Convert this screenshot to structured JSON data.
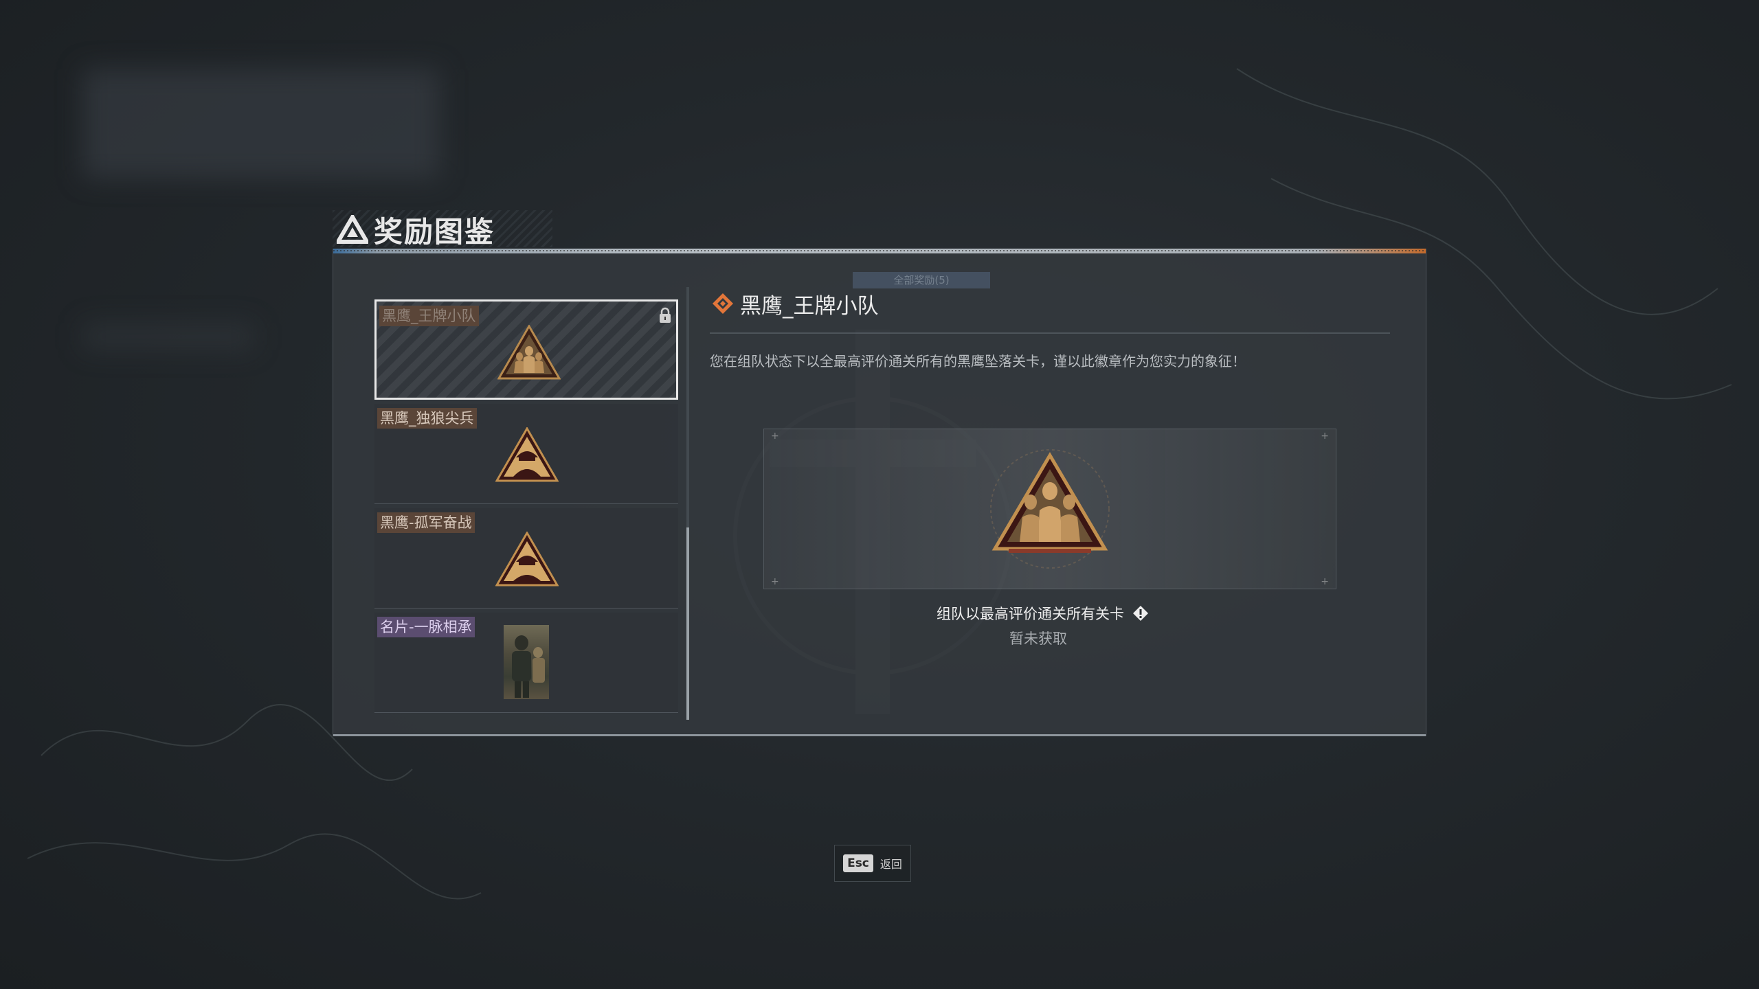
{
  "page": {
    "title": "奖励图鉴"
  },
  "panel": {
    "ghost_tab": "全部奖励(5)"
  },
  "rewards": [
    {
      "tag": "黑鹰_王牌小队",
      "selected": true,
      "locked": true
    },
    {
      "tag": "黑鹰_独狼尖兵"
    },
    {
      "tag": "黑鹰-孤军奋战"
    },
    {
      "tag": "名片-一脉相承"
    }
  ],
  "detail": {
    "title": "黑鹰_王牌小队",
    "description": "您在组队状态下以全最高评价通关所有的黑鹰坠落关卡，谨以此徽章作为您实力的象征！",
    "condition": "组队以最高评价通关所有关卡",
    "status": "暂未获取"
  },
  "footer": {
    "esc_key": "Esc",
    "esc_label": "返回"
  },
  "colors": {
    "accent_orange": "#e2763a",
    "badge_gold": "#c89a55",
    "tag_brown": "#5a4538",
    "tag_purple": "#5b4d70"
  }
}
